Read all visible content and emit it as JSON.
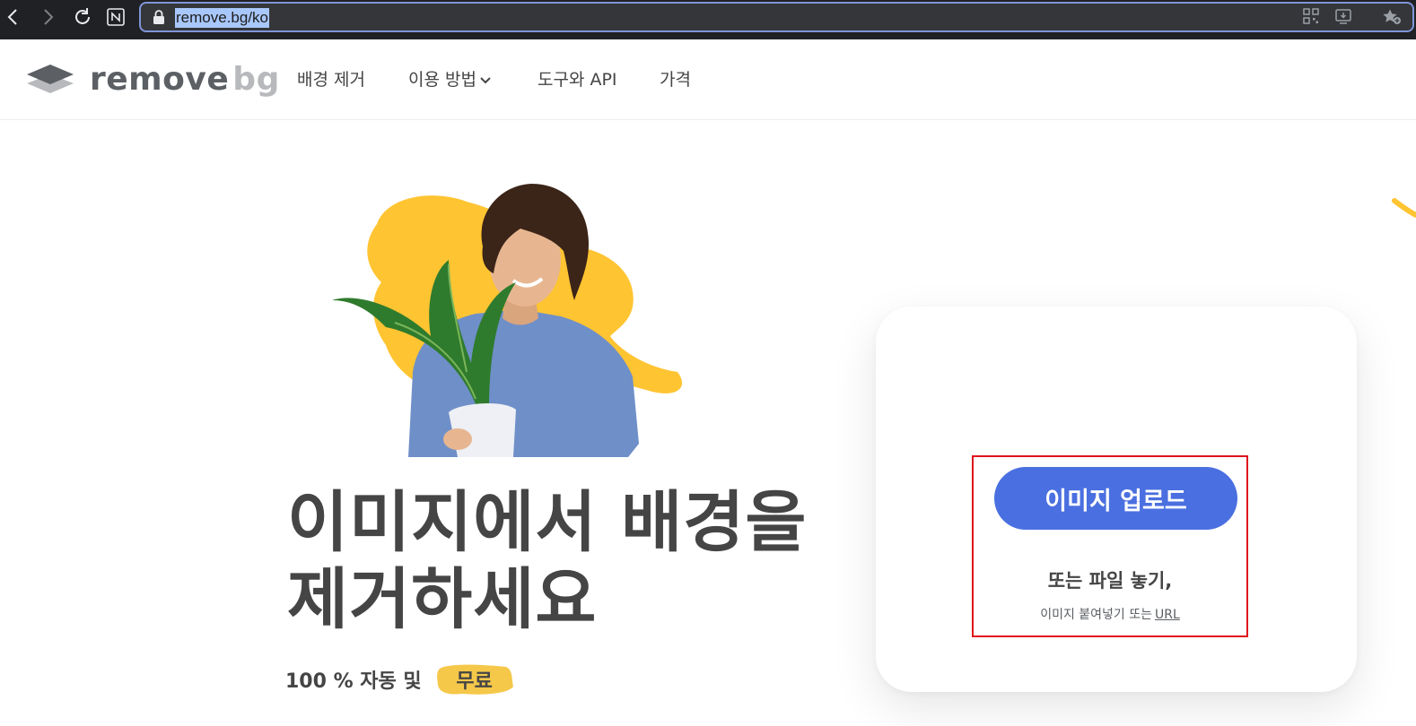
{
  "browser": {
    "url": "remove.bg/ko",
    "icons": [
      "back-icon",
      "forward-icon",
      "reload-icon",
      "notion-icon",
      "lock-icon",
      "qr-code-icon",
      "install-app-icon",
      "favorites-icon"
    ]
  },
  "site": {
    "logo": {
      "word1": "remove",
      "word2": "bg"
    },
    "nav": [
      {
        "label": "배경 제거"
      },
      {
        "label": "이용 방법",
        "has_dropdown": true
      },
      {
        "label": "도구와 API"
      },
      {
        "label": "가격"
      }
    ]
  },
  "hero": {
    "title_line1": "이미지에서 배경을",
    "title_line2": "제거하세요",
    "subtitle": "100 % 자동 및",
    "badge": "무료"
  },
  "upload": {
    "button_label": "이미지 업로드",
    "drop_text": "또는 파일 놓기,",
    "paste_text": "이미지 붙여넣기 또는",
    "url_link": "URL"
  },
  "colors": {
    "accent": "#4a6fe0",
    "yellow": "#ffc432",
    "text": "#454545",
    "highlight": "#e0121c"
  }
}
